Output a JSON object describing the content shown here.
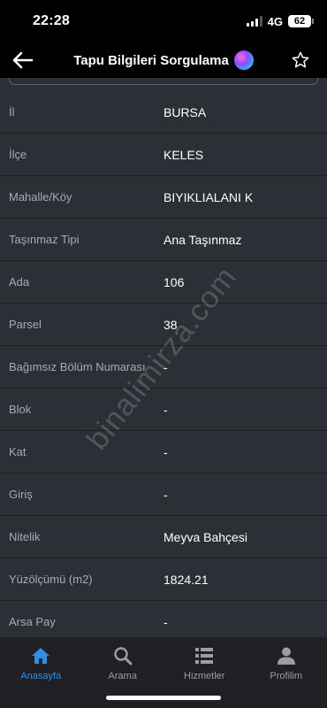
{
  "status": {
    "time": "22:28",
    "network": "4G",
    "battery": "62"
  },
  "nav": {
    "title": "Tapu Bilgileri Sorgulama"
  },
  "rows": [
    {
      "label": "İl",
      "value": "BURSA"
    },
    {
      "label": "İlçe",
      "value": "KELES"
    },
    {
      "label": "Mahalle/Köy",
      "value": "BIYIKLIALANI K"
    },
    {
      "label": "Taşınmaz Tipi",
      "value": "Ana Taşınmaz"
    },
    {
      "label": "Ada",
      "value": "106"
    },
    {
      "label": "Parsel",
      "value": "38"
    },
    {
      "label": "Bağımsız Bölüm Numarası",
      "value": "-"
    },
    {
      "label": "Blok",
      "value": "-"
    },
    {
      "label": "Kat",
      "value": "-"
    },
    {
      "label": "Giriş",
      "value": "-"
    },
    {
      "label": "Nitelik",
      "value": "Meyva Bahçesi"
    },
    {
      "label": "Yüzölçümü (m2)",
      "value": "1824.21"
    },
    {
      "label": "Arsa Pay",
      "value": "-"
    }
  ],
  "watermark": "binalimirza.com",
  "tabs": [
    {
      "label": "Anasayfa",
      "icon": "home-icon",
      "active": true
    },
    {
      "label": "Arama",
      "icon": "search-icon",
      "active": false
    },
    {
      "label": "Hizmetler",
      "icon": "list-icon",
      "active": false
    },
    {
      "label": "Profilim",
      "icon": "person-icon",
      "active": false
    }
  ],
  "colors": {
    "accent": "#2f8ee6",
    "background": "#2c2f36",
    "tabbar": "#1e2024"
  }
}
